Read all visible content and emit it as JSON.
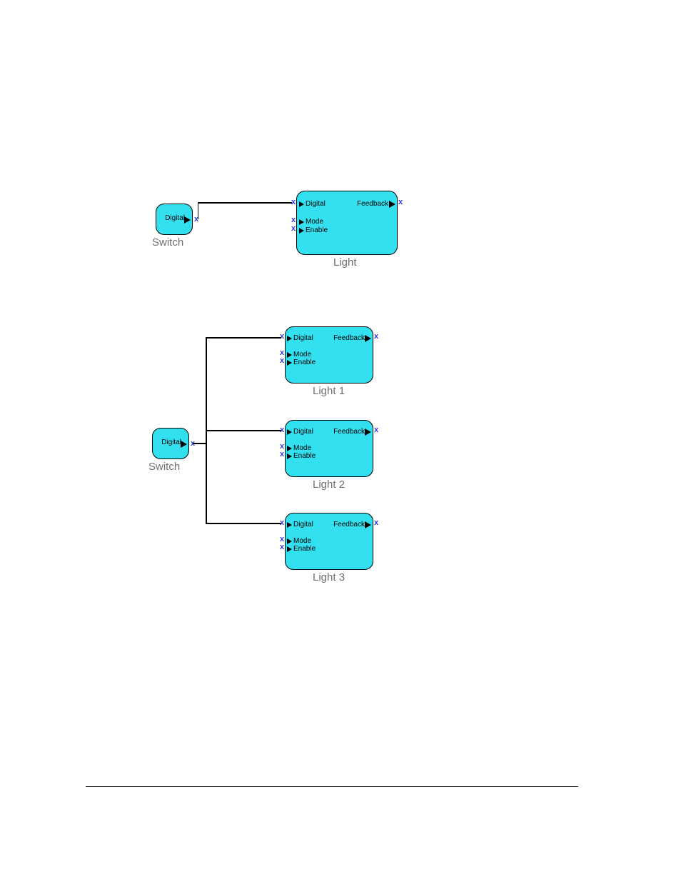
{
  "diagram1": {
    "switch": {
      "label": "Switch",
      "port": "Digital"
    },
    "light": {
      "label": "Light",
      "ports": {
        "in1": "Digital",
        "in2": "Mode",
        "in3": "Enable",
        "out": "Feedback"
      }
    }
  },
  "diagram2": {
    "switch": {
      "label": "Switch",
      "port": "Digital"
    },
    "light1": {
      "label": "Light 1",
      "ports": {
        "in1": "Digital",
        "in2": "Mode",
        "in3": "Enable",
        "out": "Feedback"
      }
    },
    "light2": {
      "label": "Light 2",
      "ports": {
        "in1": "Digital",
        "in2": "Mode",
        "in3": "Enable",
        "out": "Feedback"
      }
    },
    "light3": {
      "label": "Light 3",
      "ports": {
        "in1": "Digital",
        "in2": "Mode",
        "in3": "Enable",
        "out": "Feedback"
      }
    }
  }
}
